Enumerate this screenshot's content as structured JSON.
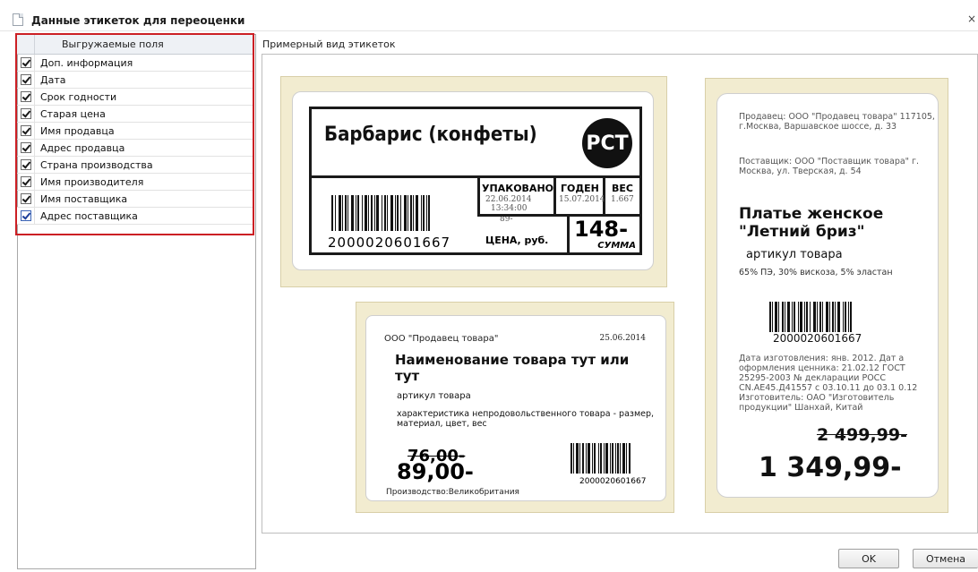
{
  "window": {
    "title": "Данные этикеток для переоценки",
    "close": "×"
  },
  "fields": {
    "header": "Выгружаемые поля",
    "items": [
      {
        "label": "Доп. информация",
        "checked": true
      },
      {
        "label": "Дата",
        "checked": true
      },
      {
        "label": "Срок годности",
        "checked": true
      },
      {
        "label": "Старая цена",
        "checked": true
      },
      {
        "label": "Имя продавца",
        "checked": true
      },
      {
        "label": "Адрес продавца",
        "checked": true
      },
      {
        "label": "Страна производства",
        "checked": true
      },
      {
        "label": "Имя производителя",
        "checked": true
      },
      {
        "label": "Имя поставщика",
        "checked": true
      },
      {
        "label": "Адрес поставщика",
        "checked": true
      }
    ]
  },
  "preview": {
    "caption": "Примерный вид этикеток",
    "label1": {
      "name": "Барбарис (конфеты)",
      "logo": "РСТ",
      "packed_hdr": "УПАКОВАНО",
      "packed_date": "22.06.2014",
      "packed_time": "13:34:00",
      "packed_extra": "89-",
      "best_hdr": "ГОДЕН",
      "best_date": "15.07.2014",
      "weight_hdr": "ВЕС",
      "weight_val": "1.667",
      "barcode": "2000020601667",
      "currency": "ЦЕНА, руб.",
      "price": "148-",
      "sum": "СУММА"
    },
    "label2": {
      "seller": "Продавец: ООО \"Продавец товара\" 117105, г.Москва, Варшавское шоссе, д. 33",
      "supplier": "Поставщик: ООО \"Поставщик товара\" г. Москва, ул. Тверская, д. 54",
      "product": "Платье женское \"Летний бриз\"",
      "article": "артикул товара",
      "composition": "65% ПЭ, 30% вискоза, 5% эластан",
      "barcode": "2000020601667",
      "details": "Дата изготовления: янв. 2012. Дат а оформления ценника: 21.02.12 ГОСТ 25295-2003 № декларации РОСС CN.AE45.Д41557 с 03.10.11 до 03.1 0.12 Изготовитель: ОАО \"Изготовитель продукции\" Шанхай, Китай",
      "old_price": "2 499,99-",
      "new_price": "1 349,99-"
    },
    "label3": {
      "seller": "ООО \"Продавец товара\"",
      "date": "25.06.2014",
      "name": "Наименование товара тут или тут",
      "article": "артикул товара",
      "description": "характеристика непродовольственного товара - размер, материал, цвет, вес",
      "old_price": "76,00-",
      "new_price": "89,00-",
      "origin": "Производство:Великобритания",
      "barcode": "2000020601667"
    }
  },
  "buttons": {
    "ok": "OK",
    "cancel": "Отмена"
  },
  "colors": {
    "highlight_border": "#cc1f24",
    "label_backing": "#f2ecd0"
  }
}
